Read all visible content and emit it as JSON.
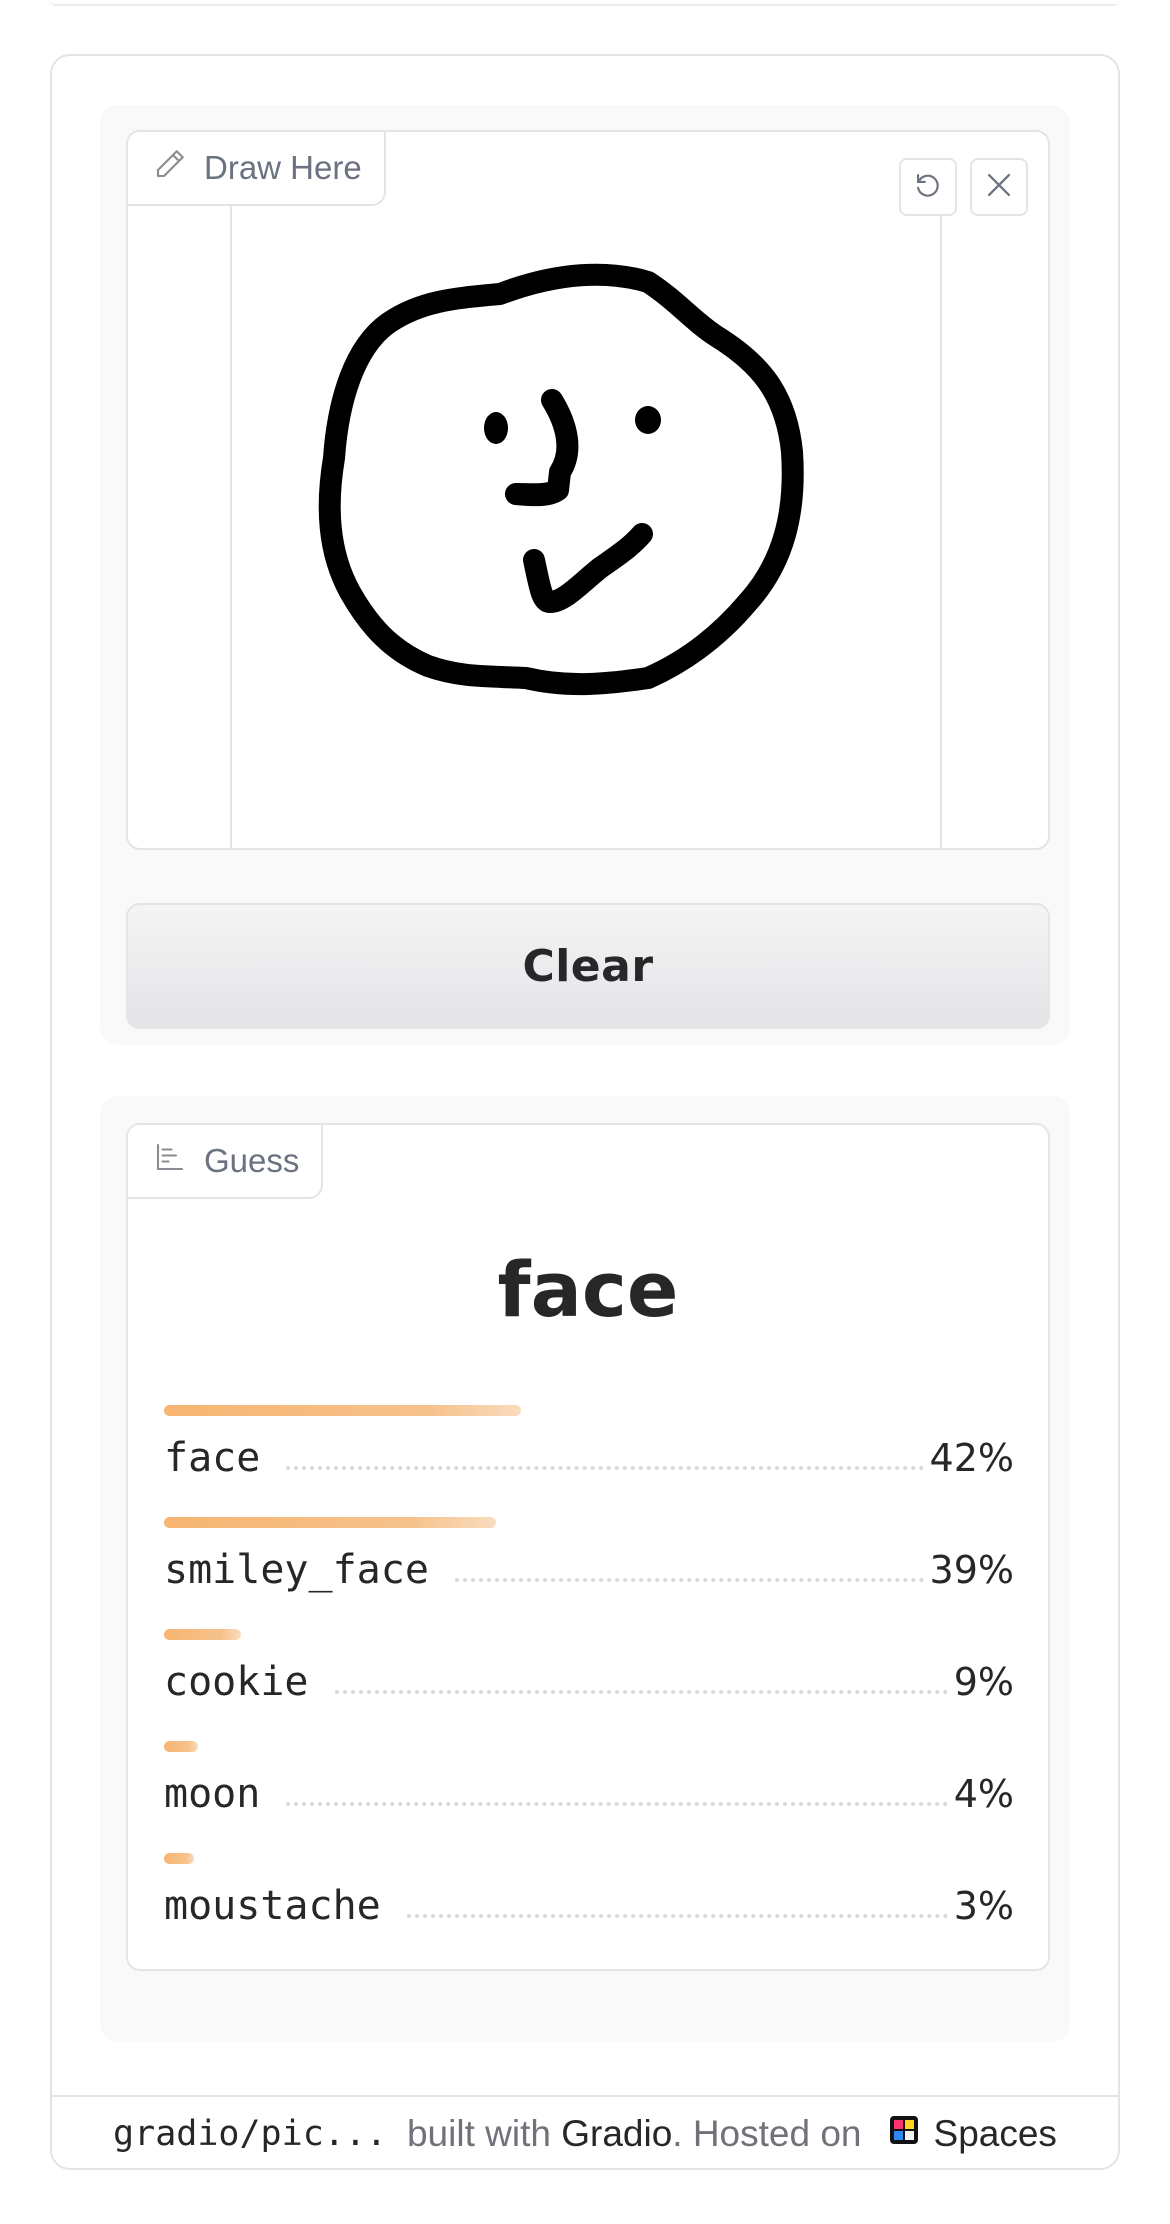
{
  "sketchpad": {
    "label": "Draw Here",
    "icon": "pencil-icon",
    "undo_icon": "undo-icon",
    "close_icon": "close-icon"
  },
  "clear_button": {
    "label": "Clear"
  },
  "guess": {
    "label": "Guess",
    "icon": "bar-chart-icon",
    "top_label": "face",
    "confidences": [
      {
        "label": "face",
        "value": "42%",
        "fraction": 0.42
      },
      {
        "label": "smiley_face",
        "value": "39%",
        "fraction": 0.39
      },
      {
        "label": "cookie",
        "value": "9%",
        "fraction": 0.09
      },
      {
        "label": "moon",
        "value": "4%",
        "fraction": 0.04
      },
      {
        "label": "moustache",
        "value": "3%",
        "fraction": 0.03
      }
    ]
  },
  "footer": {
    "repo": "gradio/pic...",
    "built_with": "built with",
    "gradio_link": "Gradio",
    "hosted_on": ". Hosted on",
    "spaces_link": "Spaces",
    "spaces_icon": "spaces-logo-icon"
  },
  "colors": {
    "bar": "#f4a857",
    "border": "#e4e4e7",
    "text": "#27272a",
    "muted": "#6b7280"
  }
}
